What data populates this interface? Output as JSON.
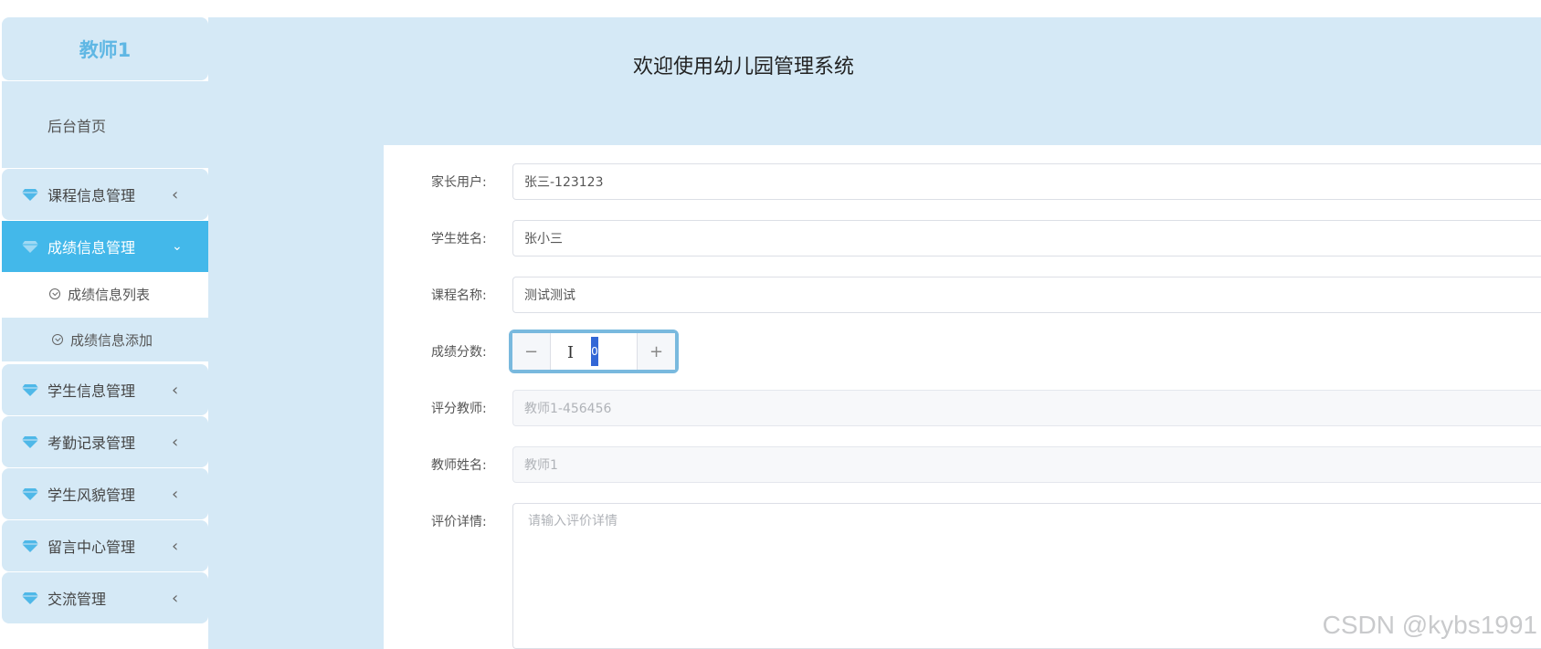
{
  "sidebar": {
    "user_title": "教师1",
    "home": "后台首页",
    "items": [
      {
        "label": "课程信息管理",
        "chevron": "‹"
      },
      {
        "label": "成绩信息管理",
        "chevron": "⌄"
      },
      {
        "label": "学生信息管理",
        "chevron": "‹"
      },
      {
        "label": "考勤记录管理",
        "chevron": "‹"
      },
      {
        "label": "学生风貌管理",
        "chevron": "‹"
      },
      {
        "label": "留言中心管理",
        "chevron": "‹"
      },
      {
        "label": "交流管理",
        "chevron": "‹"
      }
    ],
    "sub_items": [
      {
        "label": "成绩信息列表"
      },
      {
        "label": "成绩信息添加"
      }
    ]
  },
  "header": {
    "title": "欢迎使用幼儿园管理系统"
  },
  "form": {
    "parent_user": {
      "label": "家长用户:",
      "value": "张三-123123"
    },
    "student_name": {
      "label": "学生姓名:",
      "value": "张小三"
    },
    "course_name": {
      "label": "课程名称:",
      "value": "测试测试"
    },
    "score": {
      "label": "成绩分数:",
      "value": "0",
      "minus": "−",
      "plus": "+"
    },
    "grading_teacher": {
      "label": "评分教师:",
      "value": "教师1-456456"
    },
    "teacher_name": {
      "label": "教师姓名:",
      "value": "教师1"
    },
    "evaluation": {
      "label": "评价详情:",
      "placeholder": "请输入评价详情"
    }
  },
  "watermark": "CSDN @kybs1991",
  "colors": {
    "accent": "#43b8ea",
    "panel": "#d5e9f6",
    "title": "#5fb7e4"
  }
}
